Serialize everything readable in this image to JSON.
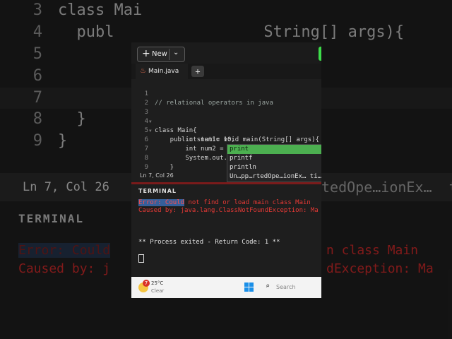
{
  "background": {
    "lines": [
      {
        "ln": "3",
        "code": "class Mai"
      },
      {
        "ln": "4",
        "code": "  publ                String[] args){"
      },
      {
        "ln": "5",
        "code": ""
      },
      {
        "ln": "6",
        "code": ""
      },
      {
        "ln": "7",
        "code": ""
      },
      {
        "ln": "8",
        "code": "  }"
      },
      {
        "ln": "9",
        "code": "}"
      }
    ],
    "status": "Ln 7, Col 26",
    "status_right": "tedOpe…ionEx…  ti",
    "terminal_title": "TERMINAL",
    "err1": "Error: Could",
    "err1_tail": "n class Main",
    "err2": "Caused by: j",
    "err2_tail": "dException: Ma"
  },
  "toolbar": {
    "new_label": "New",
    "plus": "+",
    "chevron": "⌄"
  },
  "tabs": [
    {
      "label": "Main.java"
    }
  ],
  "tab_add": "+",
  "editor": {
    "lines": [
      {
        "ln": "1",
        "text": "// relational operators in java"
      },
      {
        "ln": "2",
        "text": ""
      },
      {
        "ln": "3",
        "text": "class Main{"
      },
      {
        "ln": "4",
        "text": "    public static void main(String[] args){"
      },
      {
        "ln": "5",
        "text": "        int num1= 10;"
      },
      {
        "ln": "6",
        "text": "        int num2 = 20;"
      },
      {
        "ln": "7",
        "text": "        System.out.printl"
      },
      {
        "ln": "8",
        "text": "    }"
      },
      {
        "ln": "9",
        "text": "}"
      }
    ]
  },
  "autocomplete": [
    "print",
    "printf",
    "println",
    "Un…pp…rtedOpe…ionEx… ti…"
  ],
  "statusbar": "Ln 7, Col 26",
  "terminal": {
    "title": "TERMINAL",
    "err_hl": "Error: Could",
    "err_rest": " not find or load main class Main",
    "caused": "Caused by: java.lang.ClassNotFoundException: Ma",
    "exit": "** Process exited - Return Code: 1 **"
  },
  "taskbar": {
    "badge": "7",
    "temp": "25°C",
    "condition": "Clear",
    "search": "Search"
  },
  "colors": {
    "accent": "#3b82f6",
    "error": "#e53935",
    "suggest": "#4caf50"
  }
}
